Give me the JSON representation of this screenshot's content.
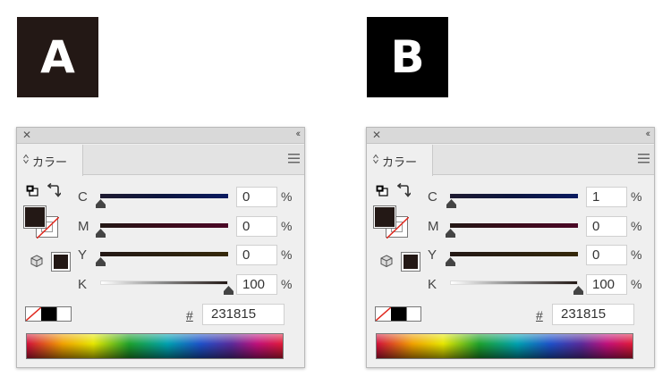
{
  "labels": {
    "a": "A",
    "b": "B"
  },
  "colors": {
    "badge_a": "#231815",
    "badge_b": "#000000",
    "fill": "#231815"
  },
  "panel_common": {
    "tab_label": "カラー",
    "channels": [
      "C",
      "M",
      "Y",
      "K"
    ],
    "percent_sign": "%",
    "hash_label": "#",
    "icons": [
      "close-icon",
      "collapse-icon",
      "tab-arrows-icon",
      "panel-menu-icon",
      "default-colors-icon",
      "swap-colors-icon",
      "out-of-gamut-icon"
    ]
  },
  "panel_a": {
    "values": {
      "c": "0",
      "m": "0",
      "y": "0",
      "k": "100"
    },
    "hex": "231815"
  },
  "panel_b": {
    "values": {
      "c": "1",
      "m": "0",
      "y": "0",
      "k": "100"
    },
    "hex": "231815"
  }
}
